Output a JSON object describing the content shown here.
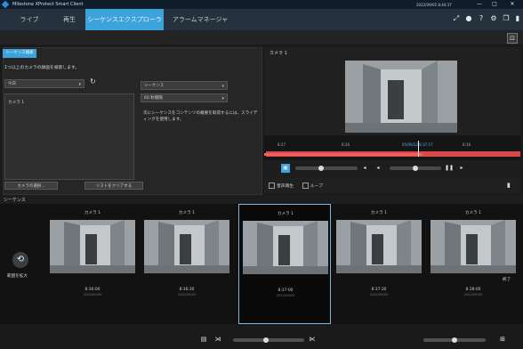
{
  "window": {
    "title": "Milestone XProtect Smart Client",
    "clock": "2022/09/05 8:44:37",
    "controls": [
      "—",
      "□",
      "✕"
    ]
  },
  "tabs": [
    {
      "label": "ライブ",
      "active": false
    },
    {
      "label": "再生",
      "active": false
    },
    {
      "label": "シーケンスエクスプローラ",
      "active": true
    },
    {
      "label": "アラームマネージャ",
      "active": false
    }
  ],
  "left_panel": {
    "tab_label": "シーケンス検索",
    "hint": "1つ以上のカメラの録画を検索します。",
    "date_select": "今日",
    "refresh_icon": "↻",
    "type_select": "シーケンス",
    "interval_select": "60 秒間隔",
    "camera_list_item": "カメラ 1",
    "help_text": "次にシーケンスをコンテンツの概要を取得するには、スライディングを使用します。",
    "buttons": {
      "select_camera": "カメラの選択...",
      "clear_list": "リストをクリアする"
    }
  },
  "video_panel": {
    "camera_title": "カメラ 1",
    "timeline_labels": [
      "8:27",
      "8:36",
      "05/09/22 8:37:17",
      "8:38"
    ],
    "checkbox_sound": "音声再生",
    "checkbox_loop": "ループ"
  },
  "sequence": {
    "header_label": "シーケンス",
    "left_side_label": "範囲を拡大",
    "right_side_label": "終了",
    "thumbnails": [
      {
        "camera": "カメラ 1",
        "time": "8:36:00",
        "sub": "2022/09/05",
        "selected": false
      },
      {
        "camera": "カメラ 1",
        "time": "8:36:30",
        "sub": "2022/09/05",
        "selected": false
      },
      {
        "camera": "カメラ 1",
        "time": "8:37:00",
        "sub": "2022/09/05",
        "selected": true
      },
      {
        "camera": "カメラ 1",
        "time": "8:37:30",
        "sub": "2022/09/05",
        "selected": false
      },
      {
        "camera": "カメラ 1",
        "time": "8:38:00",
        "sub": "2022/09/05",
        "selected": false
      }
    ]
  },
  "colors": {
    "accent": "#3da3dc",
    "timeline_red": "#d84848"
  }
}
